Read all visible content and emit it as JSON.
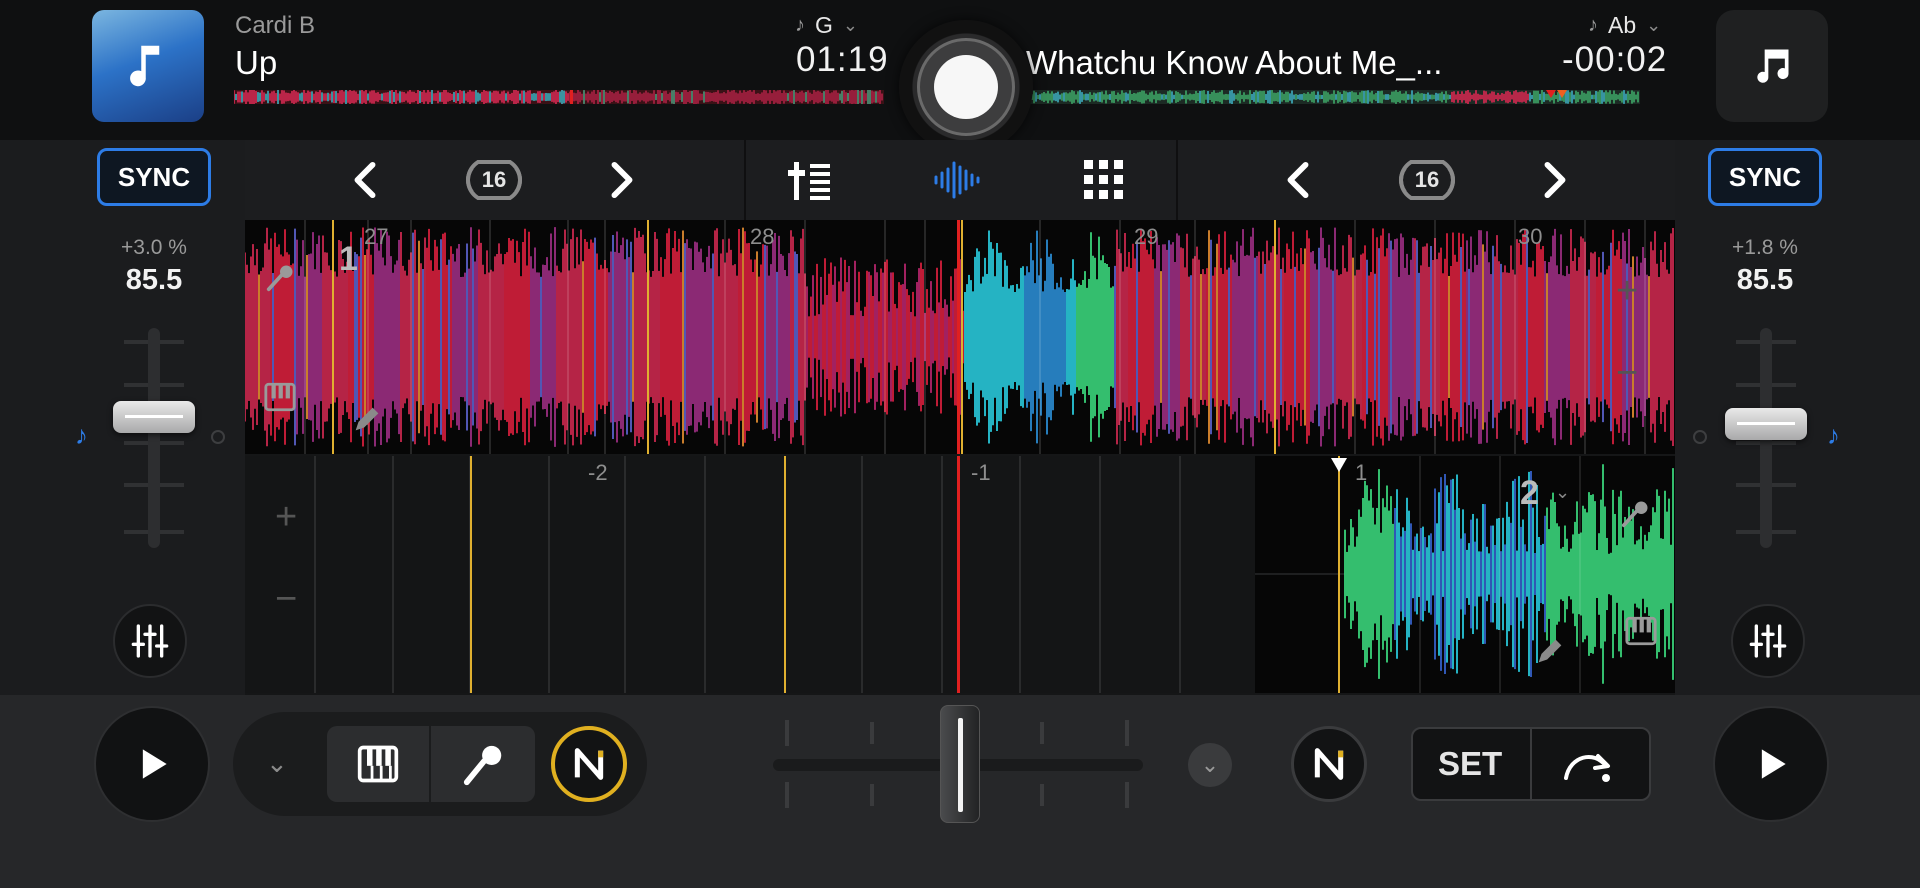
{
  "deck_left": {
    "artist": "Cardi B",
    "title": "Up",
    "key": "G",
    "time": "01:19",
    "sync_label": "SYNC",
    "pitch": "+3.0 %",
    "bpm": "85.5",
    "loop_size": "16",
    "beat_markers": [
      "27",
      "28",
      "29",
      "30"
    ],
    "hotcue": "1"
  },
  "deck_right": {
    "title": "Whatchu Know About Me_...",
    "key": "Ab",
    "time": "-00:02",
    "sync_label": "SYNC",
    "pitch": "+1.8 %",
    "bpm": "85.5",
    "loop_size": "16",
    "beat_markers": [
      "-2",
      "-1",
      "1"
    ],
    "hotcue": "2"
  },
  "bottom": {
    "set_label": "SET"
  },
  "colors": {
    "accent_blue": "#2d7ce6",
    "wave_red": "#d41f3c",
    "wave_cyan": "#29c6d8",
    "wave_green": "#3ad27a",
    "playhead": "#e02020",
    "beat_line": "#e0b030"
  },
  "icons": [
    "music-note-icon",
    "chevron-left-icon",
    "chevron-right-icon",
    "loop-icon",
    "mixer-icon",
    "waveform-icon",
    "grid-icon",
    "eq-icon",
    "play-icon",
    "piano-icon",
    "microphone-icon",
    "neural-mix-icon",
    "cue-jump-icon",
    "pencil-icon",
    "plus-icon",
    "minus-icon"
  ]
}
